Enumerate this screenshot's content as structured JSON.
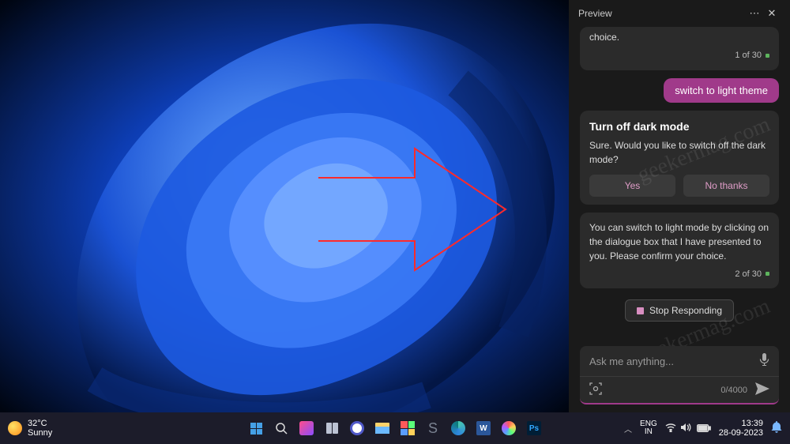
{
  "panel": {
    "title": "Preview",
    "card_cut_text": "choice.",
    "counter1": "1 of 30",
    "user_msg": "switch to light theme",
    "card2_title": "Turn off dark mode",
    "card2_body": "Sure. Would you like to switch off the dark mode?",
    "yes": "Yes",
    "no": "No thanks",
    "card3_body": "You can switch to light mode by clicking on the dialogue box that I have presented to you. Please confirm your choice.",
    "counter2": "2 of 30",
    "stop": "Stop Responding",
    "placeholder": "Ask me anything...",
    "count": "0/4000"
  },
  "taskbar": {
    "temp": "32°C",
    "condition": "Sunny",
    "lang1": "ENG",
    "lang2": "IN",
    "time": "13:39",
    "date": "28-09-2023",
    "word": "W",
    "ps": "Ps"
  },
  "watermark": "geekermag.com"
}
